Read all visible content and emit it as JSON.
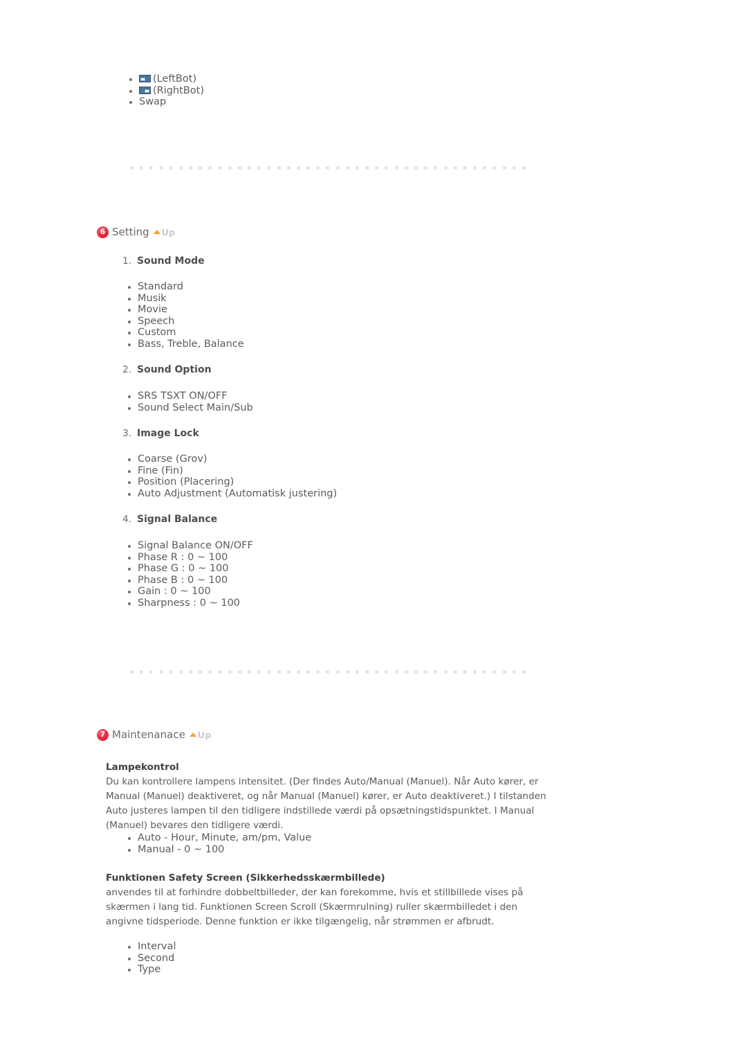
{
  "top_bullets": [
    {
      "icon": "pip-left-bottom-icon",
      "label": "(LeftBot)"
    },
    {
      "icon": "pip-right-bottom-icon",
      "label": "(RightBot)"
    },
    {
      "icon": null,
      "label": "Swap"
    }
  ],
  "separator": {
    "dot_count": 41,
    "color": "#e2e2e2"
  },
  "sections": [
    {
      "badge": "6",
      "title": "Setting",
      "up_label": "Up",
      "items": [
        {
          "number": "1.",
          "title": "Sound Mode",
          "bullets": [
            "Standard",
            "Musik",
            "Movie",
            "Speech",
            "Custom",
            "Bass, Treble, Balance"
          ]
        },
        {
          "number": "2.",
          "title": "Sound Option",
          "bullets": [
            "SRS TSXT ON/OFF",
            "Sound Select Main/Sub"
          ]
        },
        {
          "number": "3.",
          "title": "Image Lock",
          "bullets": [
            "Coarse (Grov)",
            "Fine (Fin)",
            "Position (Placering)",
            "Auto Adjustment (Automatisk justering)"
          ]
        },
        {
          "number": "4.",
          "title": "Signal Balance",
          "bullets": [
            "Signal Balance ON/OFF",
            "Phase R : 0 ~ 100",
            "Phase G : 0 ~ 100",
            "Phase B : 0 ~ 100",
            "Gain : 0 ~ 100",
            "Sharpness : 0 ~ 100"
          ]
        }
      ]
    },
    {
      "badge": "7",
      "title": "Maintenanace",
      "up_label": "Up",
      "blocks": [
        {
          "heading": "Lampekontrol",
          "paragraph": "Du kan kontrollere lampens intensitet.\n(Der findes Auto/Manual (Manuel). Når Auto kører, er Manual (Manuel) deaktiveret, og når Manual (Manuel) kører, er Auto deaktiveret.) I tilstanden Auto justeres lampen til den tidligere indstillede værdi på opsætningstidspunktet. I Manual (Manuel) bevares den tidligere værdi.",
          "bullets": [
            "Auto - Hour, Minute, am/pm, Value",
            "Manual - 0 ~ 100"
          ]
        },
        {
          "heading": "Funktionen Safety Screen (Sikkerhedsskærmbillede)",
          "paragraph": "anvendes til at forhindre dobbeltbilleder, der kan forekomme, hvis et stillbillede vises på skærmen i lang tid.\nFunktionen Screen Scroll (Skærmrulning) ruller skærmbilledet i den angivne tidsperiode.\nDenne funktion er ikke tilgængelig, når strømmen er afbrudt.",
          "bullets": [
            "Interval",
            "Second",
            "Type"
          ]
        }
      ]
    }
  ],
  "colors": {
    "badge_red": "#e8253c",
    "up_caret_orange": "#f0a030",
    "pip_blue": "#4a749a",
    "body_text": "#5b5b5d",
    "heading_text": "#3f3f41"
  }
}
